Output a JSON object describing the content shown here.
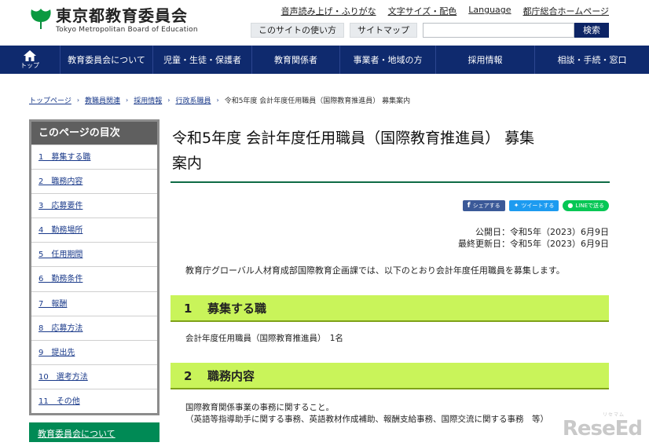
{
  "header": {
    "logo_title": "東京都教育委員会",
    "logo_subtitle": "Tokyo Metropolitan Board of Education",
    "util_links": [
      "音声読み上げ・ふりがな",
      "文字サイズ・配色",
      "Language",
      "都庁総合ホームページ"
    ],
    "how_to_use": "このサイトの使い方",
    "sitemap": "サイトマップ",
    "search_placeholder": "",
    "search_button": "検索"
  },
  "gnav": {
    "home_label": "トップ",
    "items": [
      "教育委員会について",
      "児童・生徒・保護者",
      "教育関係者",
      "事業者・地域の方",
      "採用情報",
      "相談・手続・窓口"
    ]
  },
  "breadcrumb": {
    "links": [
      "トップページ",
      "教職員関連",
      "採用情報",
      "行政系職員"
    ],
    "current": "令和5年度 会計年度任用職員（国際教育推進員） 募集案内"
  },
  "sidebar": {
    "title": "このページの目次",
    "items": [
      "1　募集する職",
      "2　職務内容",
      "3　応募要件",
      "4　勤務場所",
      "5　任用期間",
      "6　勤務条件",
      "7　報酬",
      "8　応募方法",
      "9　提出先",
      "10　選考方法",
      "11　その他"
    ],
    "cta": "教育委員会について"
  },
  "main": {
    "title_line1": "令和5年度 会計年度任用職員（国際教育推進員） 募集",
    "title_line2": "案内",
    "share": {
      "facebook": "シェアする",
      "twitter": "ツイートする",
      "line": "LINEで送る"
    },
    "published": "公開日：令和5年（2023）6月9日",
    "updated": "最終更新日：令和5年（2023）6月9日",
    "lead": "教育庁グローバル人材育成部国際教育企画課では、以下のとおり会計年度任用職員を募集します。",
    "sections": [
      {
        "num": "1",
        "heading": "募集する職",
        "body": [
          "会計年度任用職員（国際教育推進員）　1名"
        ]
      },
      {
        "num": "2",
        "heading": "職務内容",
        "body": [
          "国際教育関係事業の事務に関すること。",
          "（英語等指導助手に関する事務、英語教材作成補助、報酬支給事務、国際交流に関する事務　等）"
        ]
      }
    ]
  },
  "watermark": {
    "text": "ReseEd",
    "sub": "リセマム"
  },
  "colors": {
    "nav": "#0f2a6e",
    "accent_green": "#008a55",
    "section_bg": "#c9f45a",
    "rule": "#0e6b45"
  }
}
